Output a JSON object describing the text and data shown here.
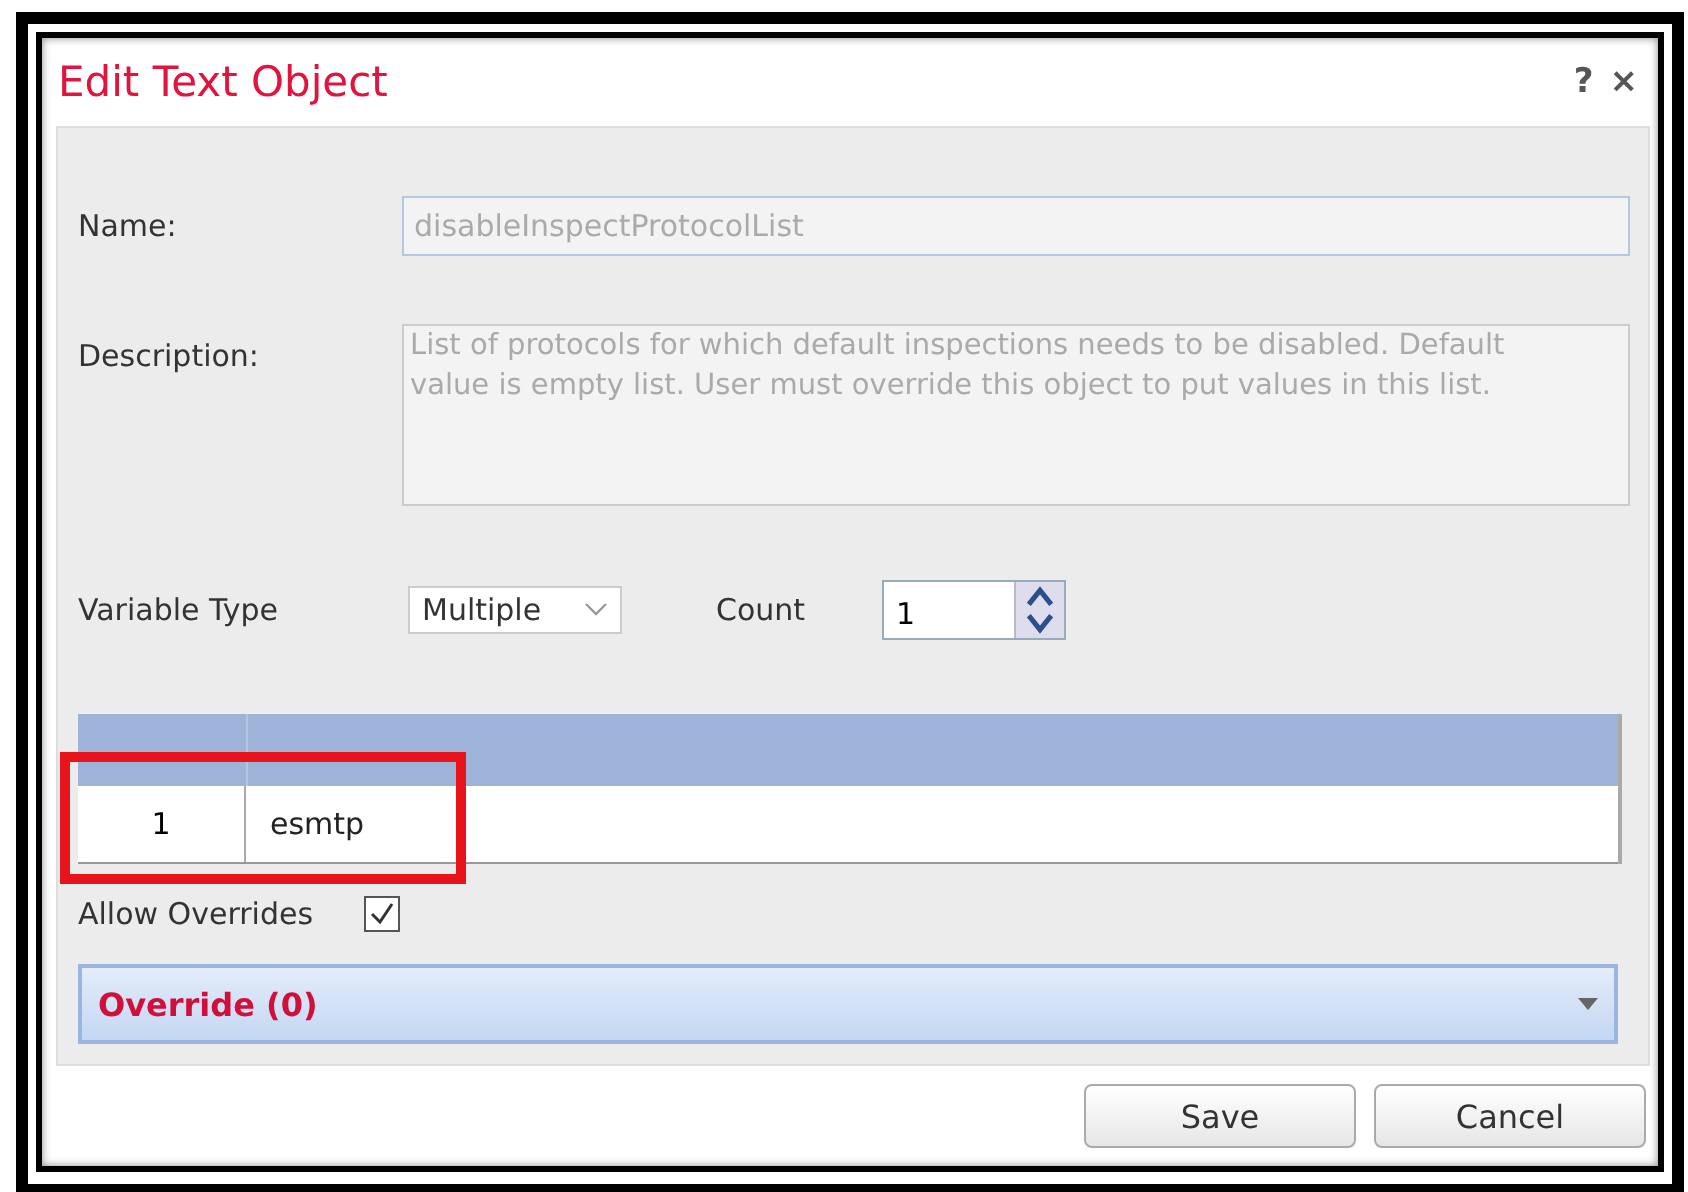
{
  "dialog": {
    "title": "Edit Text Object",
    "help": "?",
    "close": "×"
  },
  "fields": {
    "name_label": "Name:",
    "name_value": "disableInspectProtocolList",
    "description_label": "Description:",
    "description_value": "List of protocols for which default inspections needs to be disabled. Default value is empty list. User must override this object to put values in this list.",
    "variable_type_label": "Variable Type",
    "variable_type_value": "Multiple",
    "count_label": "Count",
    "count_value": "1"
  },
  "table": {
    "rows": [
      {
        "index": "1",
        "value": "esmtp",
        "highlighted": true
      }
    ]
  },
  "allow_overrides": {
    "label": "Allow Overrides",
    "checked": true
  },
  "override_panel": {
    "label": "Override (0)",
    "expanded": false
  },
  "buttons": [
    {
      "label": "Save"
    },
    {
      "label": "Cancel"
    }
  ]
}
